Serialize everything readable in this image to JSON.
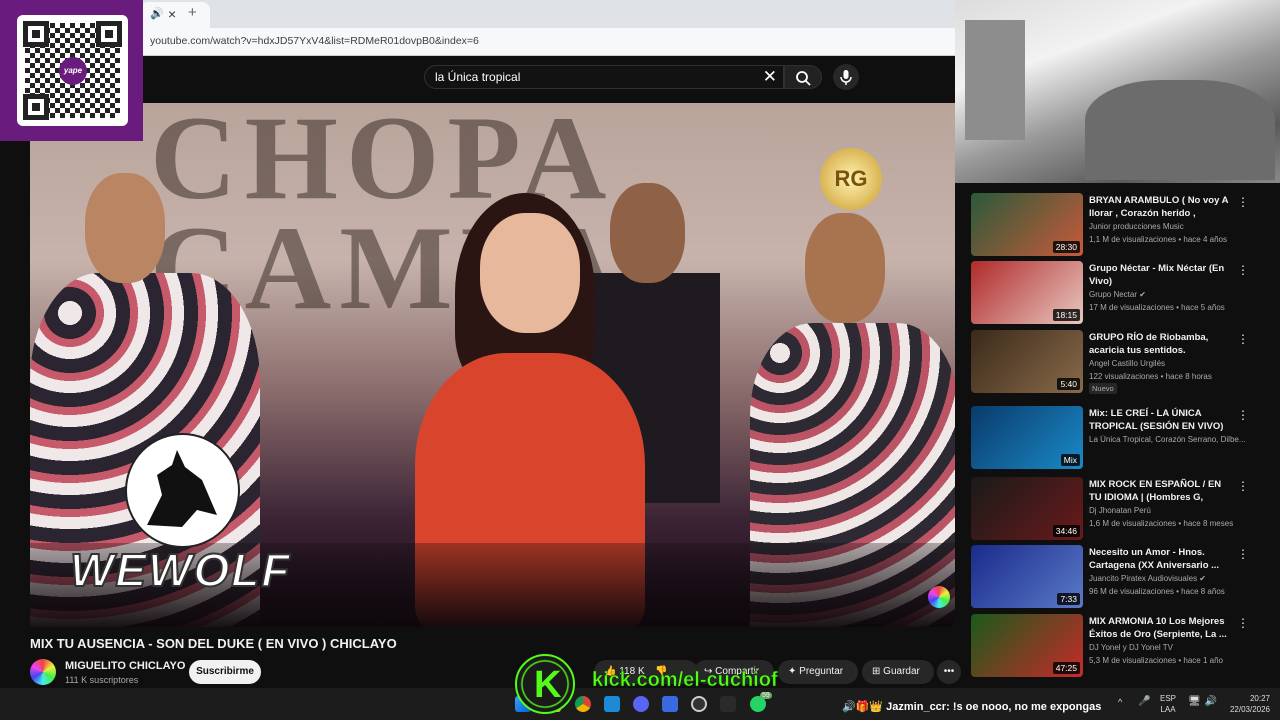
{
  "browser": {
    "tab_speaker_icon": "speaker-icon",
    "tab_close": "×",
    "new_tab": "+",
    "url": "youtube.com/watch?v=hdxJD57YxV4&list=RDMeR01dovpB0&index=6"
  },
  "search": {
    "query": "la Única tropical",
    "clear": "✕"
  },
  "video": {
    "title": "MIX TU AUSENCIA - SON DEL DUKE ( EN VIVO ) CHICLAYO",
    "wall_text": "CHOPA\nCAMPA",
    "rg_logo": "RG",
    "wolf_logo_text": "WEWOLF"
  },
  "channel": {
    "name": "MIGUELITO CHICLAYO",
    "subscribers": "111 K suscriptores",
    "subscribe_label": "Suscribirme"
  },
  "actions": {
    "likes": "118 K",
    "share": "Compartir",
    "ask": "Preguntar",
    "save": "Guardar",
    "more": "•••"
  },
  "recommendations": [
    {
      "title": "BRYAN ARAMBULO ( No voy A llorar , Corazón herido , Regres...",
      "channel": "Junior producciones Music",
      "meta": "1,1 M de visualizaciones • hace 4 años",
      "duration": "28:30",
      "badge": "",
      "colors": [
        "#2a5a3a",
        "#c85a3a"
      ]
    },
    {
      "title": "Grupo Néctar - Mix Néctar (En Vivo)",
      "channel": "Grupo Nectar ✔",
      "meta": "17 M de visualizaciones • hace 5 años",
      "duration": "18:15",
      "badge": "",
      "colors": [
        "#b02a2a",
        "#e8c8c0"
      ]
    },
    {
      "title": "GRUPO RÍO de Riobamba, acaricia tus sentidos.",
      "channel": "Angel Castillo Urgilés",
      "meta": "122 visualizaciones • hace 8 horas",
      "duration": "5:40",
      "badge": "Nuevo",
      "colors": [
        "#3a2a1a",
        "#8a6a4a"
      ]
    },
    {
      "title": "Mix: LE CREÍ - LA ÚNICA TROPICAL (SESIÓN EN VIVO)",
      "channel": "La Única Tropical, Corazón Serrano, Dilbe...",
      "meta": "",
      "duration": "Mix",
      "badge": "",
      "colors": [
        "#0a3a6a",
        "#1a8ac8"
      ]
    },
    {
      "title": "MIX ROCK EN ESPAÑOL / EN TU IDIOMA | (Hombres G, Enanito...",
      "channel": "Dj Jhonatan Perú",
      "meta": "1,6 M de visualizaciones • hace 8 meses",
      "duration": "34:46",
      "badge": "",
      "colors": [
        "#1a1a1a",
        "#6a1a1a"
      ]
    },
    {
      "title": "Necesito un Amor - Hnos. Cartagena (XX Aniversario ...",
      "channel": "Juancito Piratex Audiovisuales ✔",
      "meta": "96 M de visualizaciones • hace 8 años",
      "duration": "7:33",
      "badge": "",
      "colors": [
        "#1a2a8a",
        "#5a7ac8"
      ]
    },
    {
      "title": "MIX ARMONIA 10 Los Mejores Éxitos de Oro (Serpiente, La ...",
      "channel": "DJ Yonel y DJ Yonel TV",
      "meta": "5,3 M de visualizaciones • hace 1 año",
      "duration": "47:25",
      "badge": "",
      "colors": [
        "#1a5a1a",
        "#c82a2a"
      ]
    }
  ],
  "qr": {
    "brand": "yape"
  },
  "kick": {
    "letter": "K",
    "url": "kick.com/el-cuchiof"
  },
  "chat": {
    "icons": "🔊🎁👑",
    "user": "Jazmin_ccr",
    "message": ": !s oe nooo, no me expongas"
  },
  "taskbar": {
    "lang_top": "ESP",
    "lang_bottom": "LAA",
    "time": "20:27",
    "date": "22/03/2026",
    "chevron": "^",
    "tray_icons": "🎤",
    "tray_icons2": "🖥🔊",
    "whatsapp_badge": "59"
  }
}
